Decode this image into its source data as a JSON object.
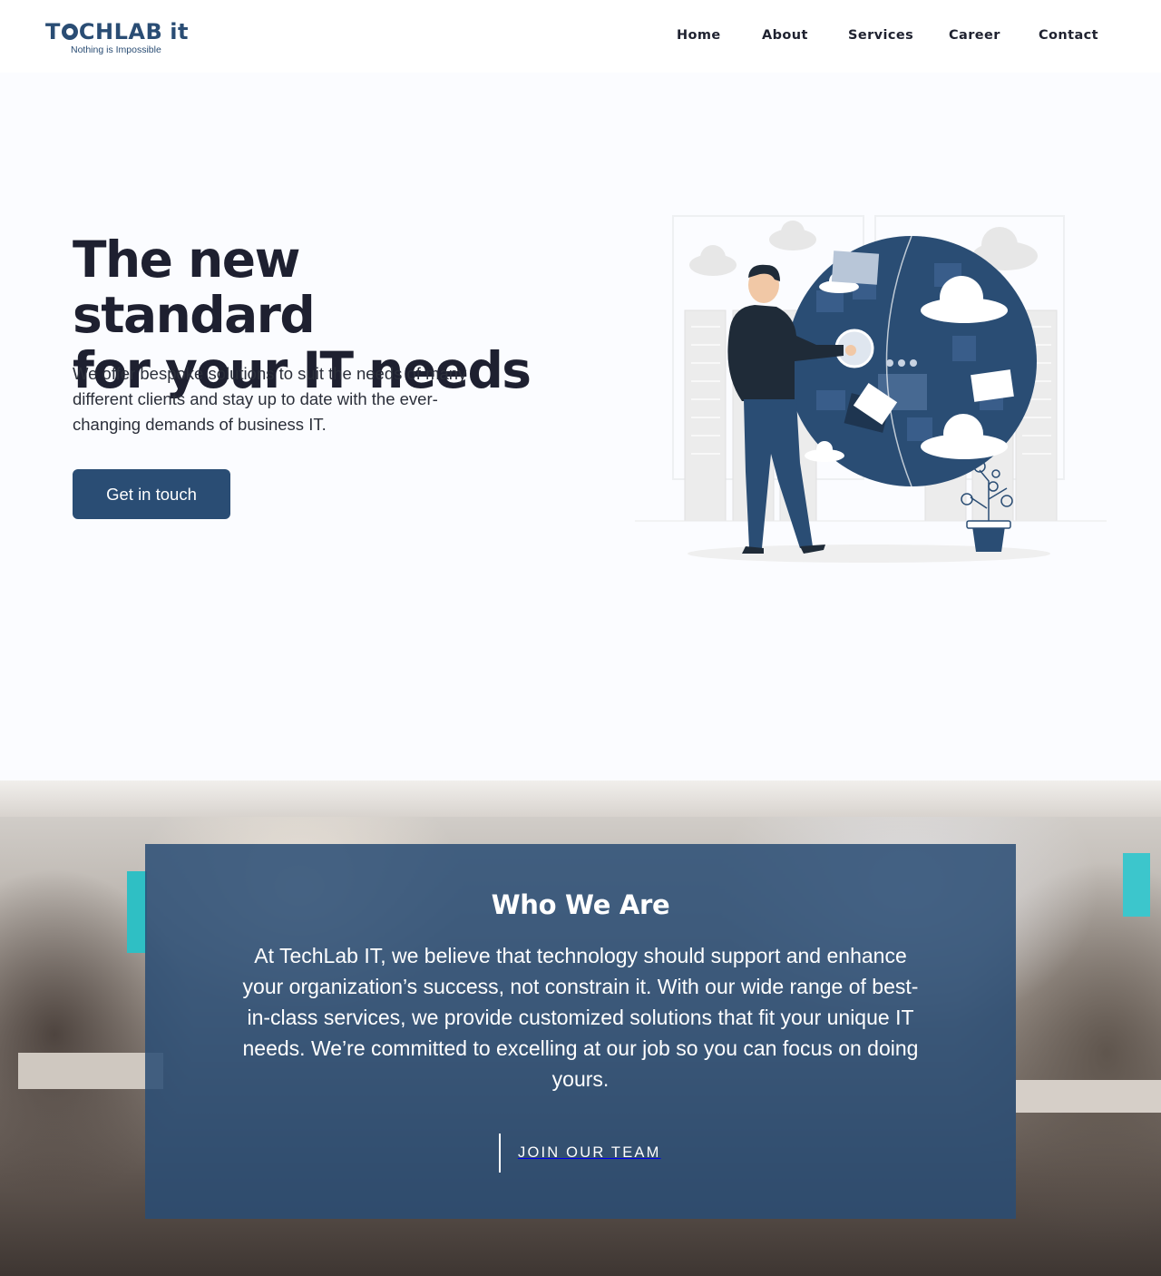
{
  "header": {
    "logo": {
      "name": "TECHLAB it",
      "tagline": "Nothing is Impossible"
    },
    "nav": [
      {
        "label": "Home"
      },
      {
        "label": "About"
      },
      {
        "label": "Services"
      },
      {
        "label": "Career"
      },
      {
        "label": "Contact"
      }
    ]
  },
  "hero": {
    "title_line1": "The new standard",
    "title_line2": "for your IT needs",
    "subtitle": "We offer bespoke solutions to suit the needs of many different clients and stay up to date with the ever-changing demands of business IT.",
    "cta_label": "Get in touch",
    "illustration": "man-with-globe-illustration"
  },
  "who_we_are": {
    "title": "Who We Are",
    "text": "At TechLab IT, we believe that technology should support and enhance your organization’s success, not constrain it. With our wide range of best-in-class services, we provide customized solutions that fit your unique IT needs. We’re committed to excelling at our job so you can focus on doing yours.",
    "join_label": "JOIN OUR TEAM",
    "background": "office-photo"
  },
  "colors": {
    "brand": "#2a4d74",
    "text": "#1e2030",
    "background": "#fbfcff"
  }
}
